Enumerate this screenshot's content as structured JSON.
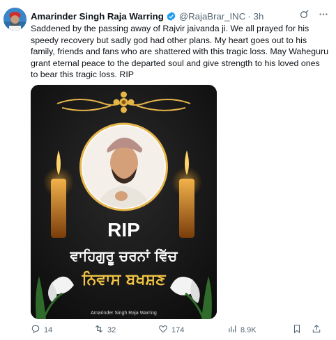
{
  "tweet": {
    "author_name": "Amarinder Singh Raja Warring",
    "handle": "@RajaBrar_INC",
    "separator": "·",
    "time": "3h",
    "text": "Saddened by the passing away of Rajvir jaivanda ji. We all prayed for his speedy recovery but sadly god had other plans. My heart goes out to his family, friends and fans who are shattered with this tragic loss. May Waheguru grant eternal peace to the departed soul and give strength to his loved ones to bear this tragic loss. RIP"
  },
  "media": {
    "rip": "RIP",
    "punjabi_line1": "ਵਾਹਿਗੁਰੂ ਚਰਨਾਂ ਵਿੱਚ",
    "punjabi_line2": "ਨਿਵਾਸ ਬਖਸ਼ਣ",
    "footer_credit": "Amarinder Singh Raja Warring"
  },
  "actions": {
    "replies": "14",
    "reposts": "32",
    "likes": "174",
    "views": "8.9K"
  },
  "colors": {
    "gold": "#e6b54a",
    "muted": "#536471",
    "verified_blue": "#1d9bf0"
  },
  "icons": [
    "grok-icon",
    "more-icon",
    "reply-icon",
    "repost-icon",
    "like-icon",
    "views-icon",
    "bookmark-icon",
    "share-icon",
    "verified-badge-icon",
    "candle-icon",
    "lily-icon"
  ]
}
